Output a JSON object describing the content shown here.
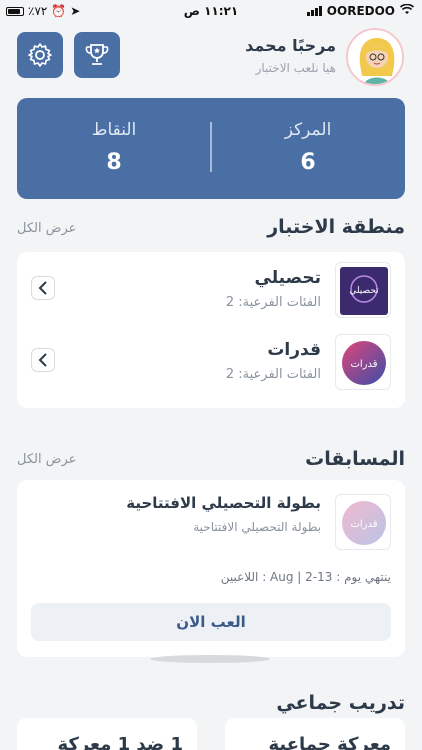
{
  "status_bar": {
    "time": "١١:٢١ ص",
    "carrier": "OOREDOO",
    "battery": "٪٧٢"
  },
  "header": {
    "greeting": "مرحبًا محمد",
    "subtitle": "هيا نلعب الاختبار"
  },
  "score": {
    "rank_label": "المركز",
    "rank_value": "6",
    "points_label": "النقاط",
    "points_value": "8"
  },
  "test_zone": {
    "title": "منطقة الاختبار",
    "view_all": "عرض الكل",
    "items": [
      {
        "title": "تحصيلي",
        "meta": "الفئات الفرعية: 2",
        "thumb_text": "تحصيلي"
      },
      {
        "title": "قدرات",
        "meta": "الفئات الفرعية: 2",
        "thumb_text": "قدرات"
      }
    ]
  },
  "competitions": {
    "title": "المسابقات",
    "view_all": "عرض الكل",
    "item": {
      "title": "بطولة التحصيلي الافتتاحية",
      "subtitle": "بطولة التحصيلي الافتتاحية",
      "date_line": "ينتهي يوم : 13-2  |  Aug : اللاعبين",
      "play_label": "العب الان",
      "thumb_text": "قدرات"
    }
  },
  "team_training": {
    "title": "تدريب جماعي",
    "cards": [
      {
        "label": "معركة جماعية"
      },
      {
        "label": "1 ضد 1 معركة"
      }
    ]
  },
  "colors": {
    "primary": "#4a6fa5",
    "background": "#f3f4f6"
  }
}
